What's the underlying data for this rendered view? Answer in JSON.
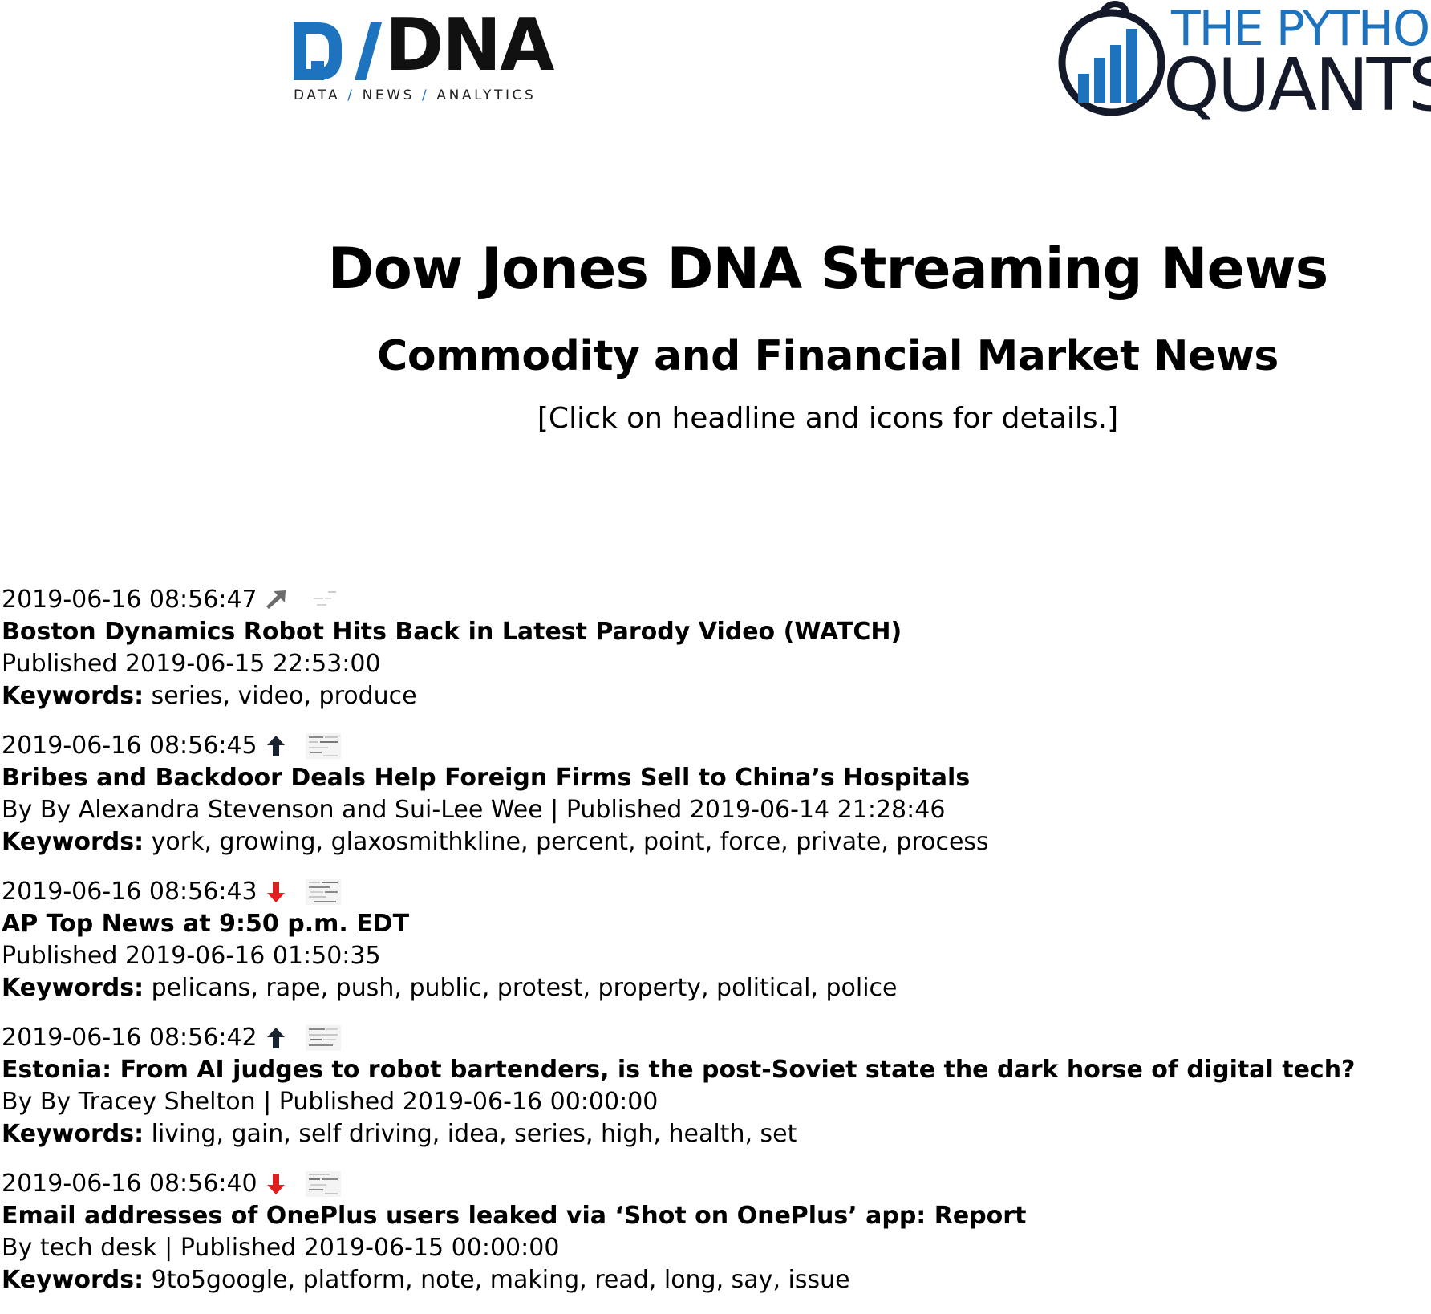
{
  "header": {
    "dna_logo": {
      "wordmark": "DNA",
      "tagline_parts": [
        "DATA",
        "NEWS",
        "ANALYTICS"
      ],
      "color": "#1e73be"
    },
    "tpq_logo": {
      "line1": "THE PYTHON",
      "line2": "QUANTS",
      "brand_color": "#1e73be",
      "dark_color": "#151a2a"
    }
  },
  "title": "Dow Jones DNA Streaming News",
  "subtitle": "Commodity and Financial Market News",
  "hint": "[Click on headline and icons for details.]",
  "keywords_label": "Keywords:",
  "news": [
    {
      "timestamp": "2019-06-16 08:56:47",
      "sentiment": "neutral-up",
      "sentiment_icon": "diagonal-arrow-icon",
      "headline": "Boston Dynamics Robot Hits Back in Latest Parody Video (WATCH)",
      "byline": "Published 2019-06-15 22:53:00",
      "keywords": "series, video, produce"
    },
    {
      "timestamp": "2019-06-16 08:56:45",
      "sentiment": "positive",
      "sentiment_icon": "arrow-up-icon",
      "headline": "Bribes and Backdoor Deals Help Foreign Firms Sell to China’s Hospitals",
      "byline": "By By Alexandra Stevenson and Sui-Lee Wee | Published 2019-06-14 21:28:46",
      "keywords": "york, growing, glaxosmithkline, percent, point, force, private, process"
    },
    {
      "timestamp": "2019-06-16 08:56:43",
      "sentiment": "negative",
      "sentiment_icon": "arrow-down-icon",
      "headline": "AP Top News at 9:50 p.m. EDT",
      "byline": "Published 2019-06-16 01:50:35",
      "keywords": "pelicans, rape, push, public, protest, property, political, police"
    },
    {
      "timestamp": "2019-06-16 08:56:42",
      "sentiment": "positive",
      "sentiment_icon": "arrow-up-icon",
      "headline": "Estonia: From AI judges to robot bartenders, is the post-Soviet state the dark horse of digital tech?",
      "byline": "By By Tracey Shelton | Published 2019-06-16 00:00:00",
      "keywords": "living, gain, self driving, idea, series, high, health, set"
    },
    {
      "timestamp": "2019-06-16 08:56:40",
      "sentiment": "negative",
      "sentiment_icon": "arrow-down-icon",
      "headline": "Email addresses of OnePlus users leaked via ‘Shot on OnePlus’ app: Report",
      "byline": "By tech desk | Published 2019-06-15 00:00:00",
      "keywords": "9to5google, platform, note, making, read, long, say, issue"
    }
  ],
  "colors": {
    "up": "#1a2330",
    "down": "#e02020",
    "neutral": "#6b6b6b"
  }
}
